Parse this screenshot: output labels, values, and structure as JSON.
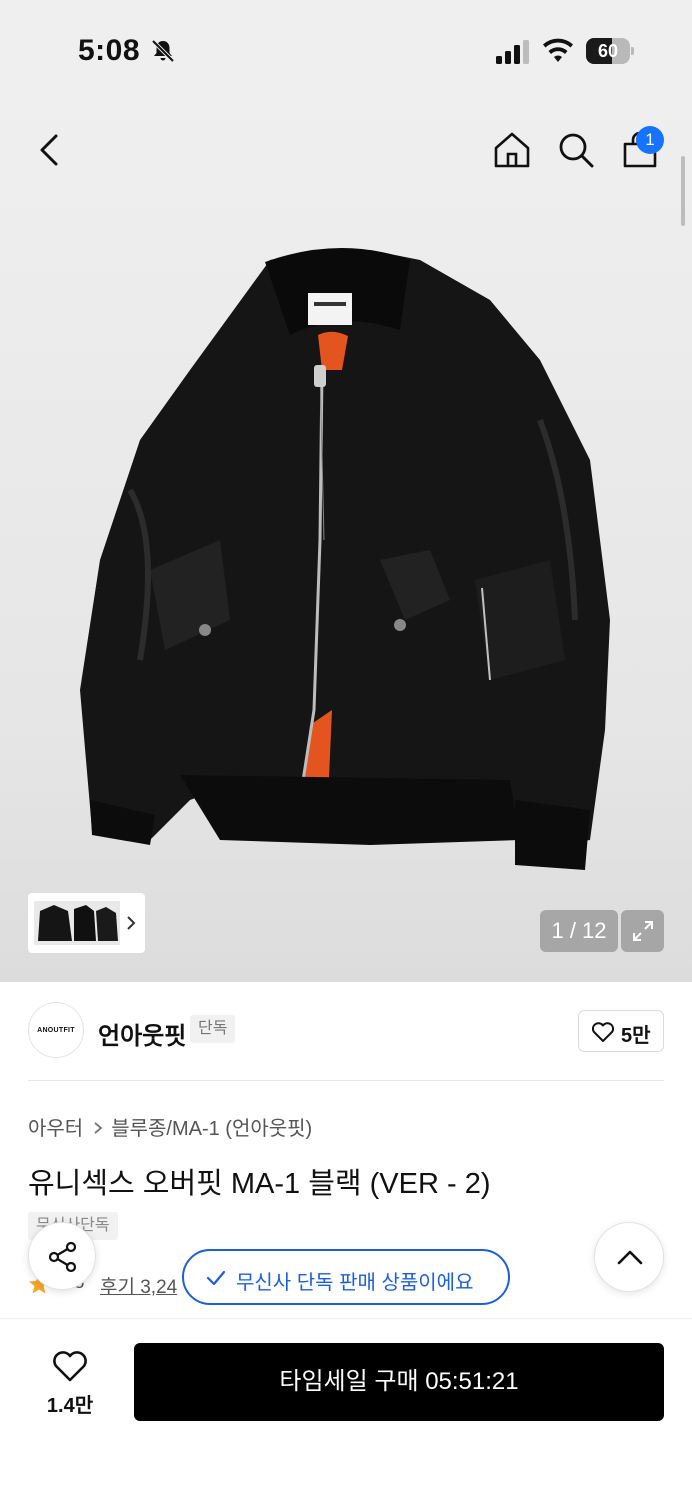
{
  "status_bar": {
    "time": "5:08",
    "battery": "60",
    "battery_level": 0.6,
    "icons": [
      "bell-slash-icon",
      "signal-icon",
      "wifi-icon",
      "battery-icon"
    ]
  },
  "nav": {
    "icons": [
      "back-icon",
      "home-icon",
      "search-icon",
      "cart-icon"
    ],
    "cart_badge": "1",
    "badge_color": "#1673ff"
  },
  "gallery": {
    "counter": "1 / 12",
    "icons": [
      "chevron-right-icon",
      "expand-icon"
    ]
  },
  "brand": {
    "logo_text": "ANOUTFIT",
    "name": "언아웃핏",
    "tag": "단독",
    "like_count": "5만"
  },
  "product": {
    "breadcrumb": [
      "아우터",
      "블루종/MA-1 (언아웃핏)"
    ],
    "title": "유니섹스 오버핏 MA-1 블랙 (VER - 2)",
    "tag": "무신사단독",
    "rating": "4.8",
    "reviews": "후기 3,24"
  },
  "toast": {
    "text": "무신사 단독 판매 상품이에요",
    "color": "#1e5fd9"
  },
  "bottom": {
    "wish_count": "1.4만",
    "buy_label": "타임세일 구매 05:51:21"
  }
}
